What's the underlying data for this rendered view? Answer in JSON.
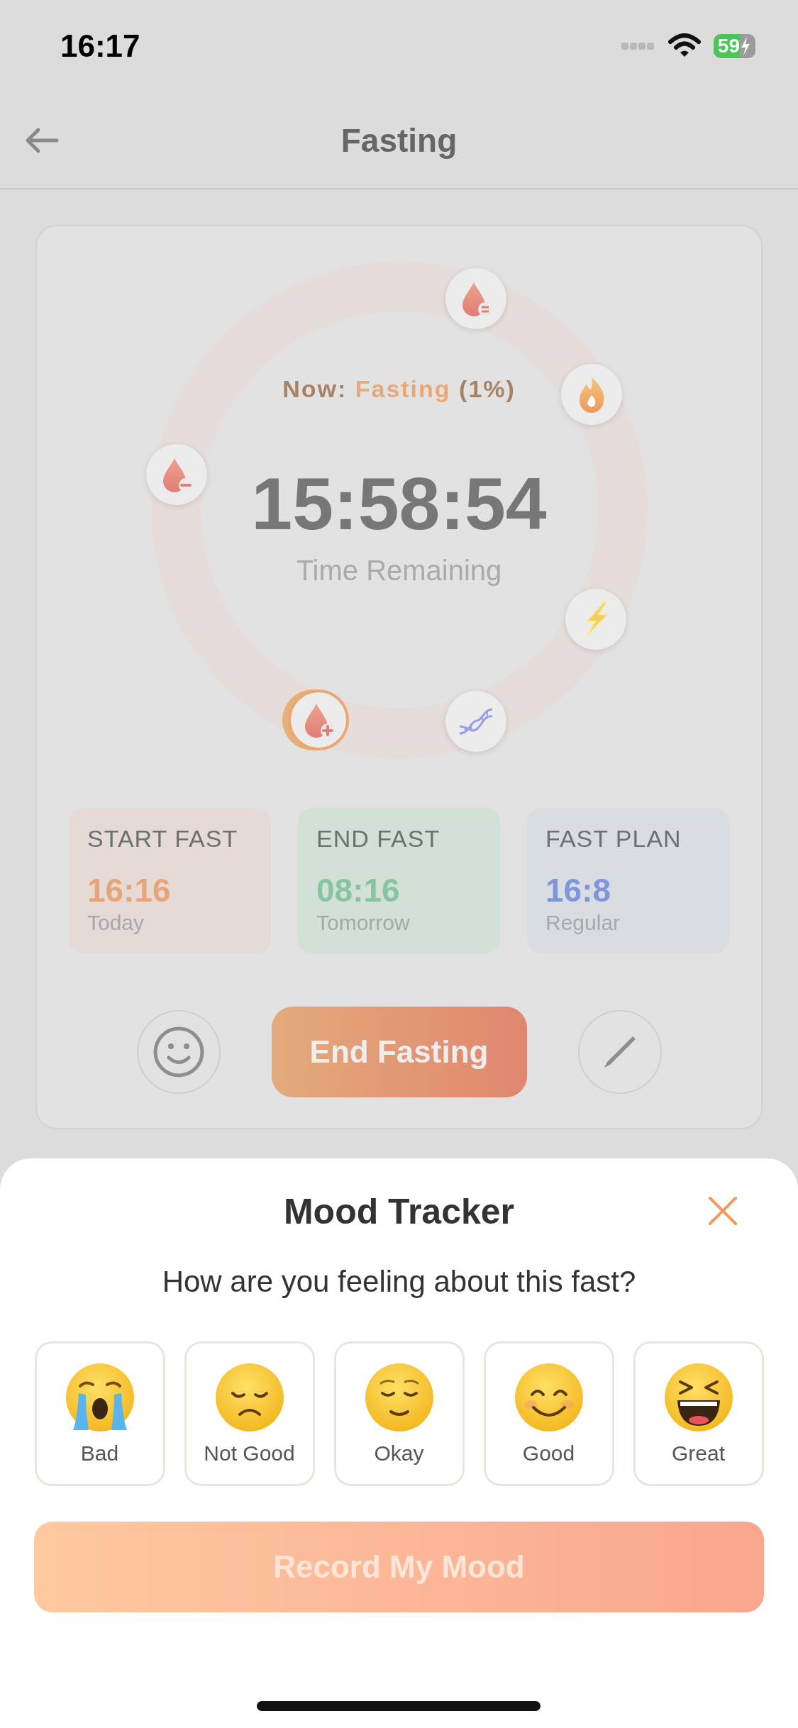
{
  "status_bar": {
    "time": "16:17",
    "battery": "59"
  },
  "header": {
    "title": "Fasting"
  },
  "timer": {
    "now_label": "Now:",
    "phase": "Fasting",
    "percent": "(1%)",
    "countdown": "15:58:54",
    "caption": "Time Remaining",
    "milestones": [
      {
        "kind": "drop-equal",
        "selected": false
      },
      {
        "kind": "fire",
        "selected": false
      },
      {
        "kind": "drop-minus",
        "selected": false
      },
      {
        "kind": "bolt",
        "selected": false
      },
      {
        "kind": "drop-plus",
        "selected": true
      },
      {
        "kind": "dna",
        "selected": false
      }
    ]
  },
  "info_cards": [
    {
      "kind": "start",
      "title": "START FAST",
      "value": "16:16",
      "sub": "Today"
    },
    {
      "kind": "end",
      "title": "END FAST",
      "value": "08:16",
      "sub": "Tomorrow"
    },
    {
      "kind": "plan",
      "title": "FAST PLAN",
      "value": "16:8",
      "sub": "Regular"
    }
  ],
  "end_button": "End Fasting",
  "mood_sheet": {
    "title": "Mood Tracker",
    "question": "How are you feeling about this fast?",
    "moods": [
      {
        "kind": "crying",
        "label": "Bad",
        "selected": false
      },
      {
        "kind": "sad",
        "label": "Not Good",
        "selected": false
      },
      {
        "kind": "relieved",
        "label": "Okay",
        "selected": false
      },
      {
        "kind": "smiling",
        "label": "Good",
        "selected": false
      },
      {
        "kind": "laughing",
        "label": "Great",
        "selected": false
      }
    ],
    "record_button": {
      "label": "Record My Mood",
      "disabled": true
    }
  }
}
